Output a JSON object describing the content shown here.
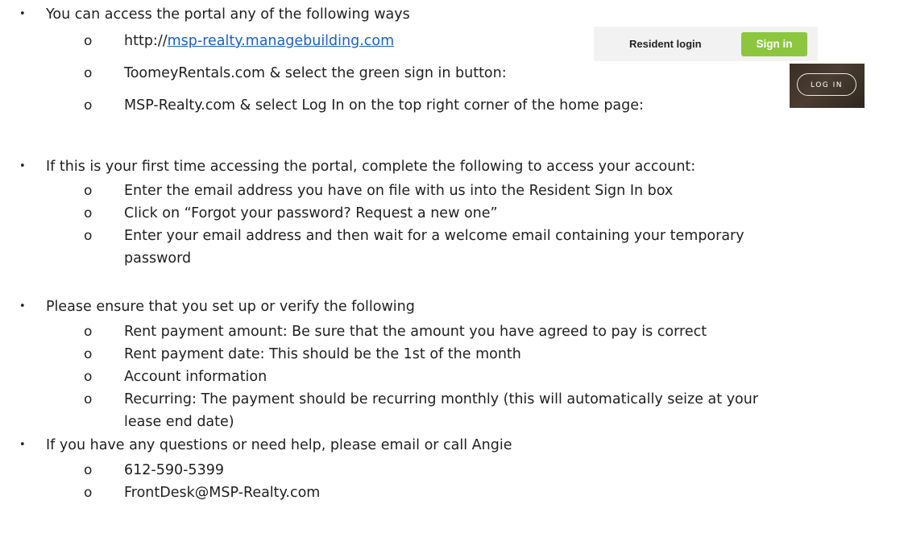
{
  "bullet_char": "•",
  "sub_bullet_char": "o",
  "section_access": {
    "heading": "You can access the portal any of the following ways",
    "url_prefix": "http://",
    "url_link": "msp-realty.managebuilding.com",
    "toomey": "ToomeyRentals.com & select the green sign in button:",
    "msp": "MSP-Realty.com & select Log In on the top right corner of the home page:"
  },
  "resident_widget": {
    "label": "Resident login",
    "button": "Sign in",
    "button_color": "#8cc63f"
  },
  "login_widget": {
    "button": "LOG IN"
  },
  "section_first_time": {
    "heading": "If this is your first time accessing the portal, complete the following to access your account:",
    "items": [
      "Enter the email address you have on file with us into the Resident Sign In box",
      "Click on “Forgot your password? Request a new one”",
      "Enter your email address and then wait for a welcome email containing your temporary",
      "password"
    ]
  },
  "section_verify": {
    "heading": "Please ensure that you set up or verify the following",
    "items": [
      "Rent payment amount:  Be sure that the amount you have agreed to pay is correct",
      "Rent payment date:  This should be the 1st of the month",
      "Account information",
      "Recurring:  The payment should be recurring monthly (this will automatically seize at your",
      "lease end date)"
    ]
  },
  "section_help": {
    "heading": "If you have any questions or need help, please email or call Angie",
    "phone": "612-590-5399",
    "email": "FrontDesk@MSP-Realty.com"
  }
}
